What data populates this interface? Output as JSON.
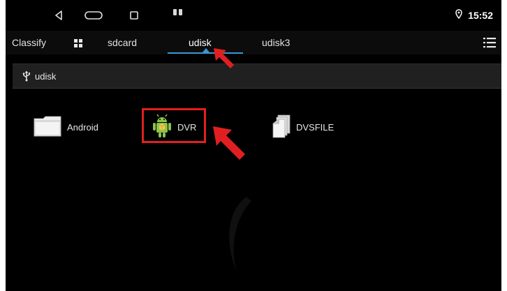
{
  "status_bar": {
    "time": "15:52",
    "icons": [
      "back-icon",
      "home-icon",
      "recents-icon",
      "usb-icon",
      "location-icon"
    ]
  },
  "tabs": [
    {
      "label": "Classify"
    },
    {
      "label": "sdcard"
    },
    {
      "label": "udisk",
      "selected": true
    },
    {
      "label": "udisk3"
    }
  ],
  "path": {
    "label": "udisk",
    "icon": "usb-icon"
  },
  "files": [
    {
      "name": "Android",
      "icon": "folder-icon"
    },
    {
      "name": "DVR",
      "icon": "android-app-icon",
      "highlighted": true
    },
    {
      "name": "DVSFILE",
      "icon": "document-icon"
    }
  ],
  "annotation_color": "#e02020",
  "accent_color": "#3a95d6"
}
